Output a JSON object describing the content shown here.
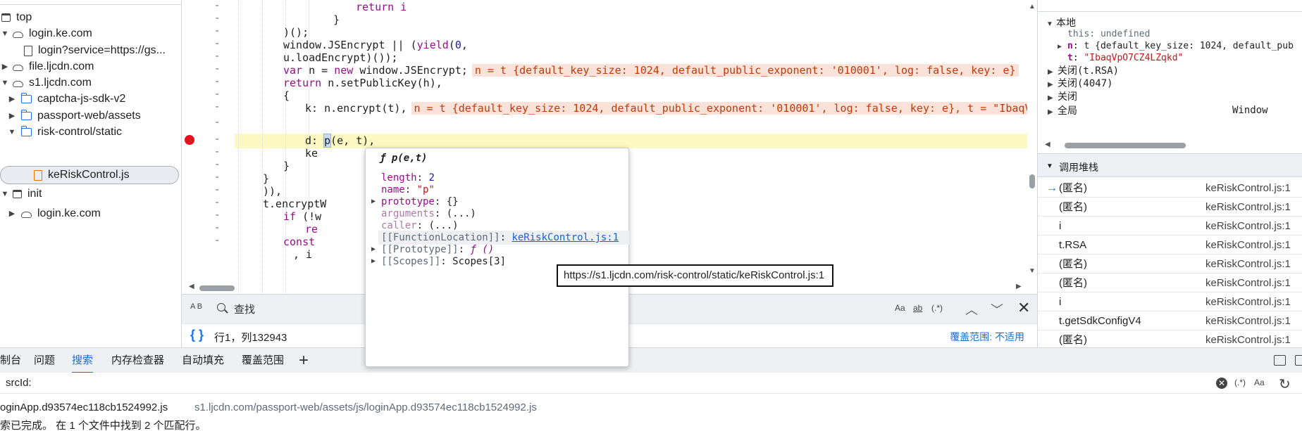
{
  "file_tree": {
    "items": [
      {
        "label": "top",
        "icon": "frame-icon",
        "expanded": true
      },
      {
        "label": "login.ke.com",
        "icon": "cloud-icon",
        "expanded": true
      },
      {
        "label": "login?service=https://gs...",
        "icon": "file-icon"
      },
      {
        "label": "file.ljcdn.com",
        "icon": "cloud-icon",
        "expanded": false
      },
      {
        "label": "s1.ljcdn.com",
        "icon": "cloud-icon",
        "expanded": true
      },
      {
        "label": "captcha-js-sdk-v2",
        "icon": "folder-icon",
        "expanded": false
      },
      {
        "label": "passport-web/assets",
        "icon": "folder-icon",
        "expanded": false
      },
      {
        "label": "risk-control/static",
        "icon": "folder-icon",
        "expanded": true
      },
      {
        "label": "keRiskControl.js",
        "icon": "js-file-icon",
        "selected": true
      },
      {
        "label": "init",
        "icon": "frame-icon",
        "expanded": true
      },
      {
        "label": "login.ke.com",
        "icon": "cloud-icon",
        "expanded": false
      }
    ]
  },
  "editor": {
    "gutter_marker": "-",
    "lines": [
      {
        "t1": "return i"
      },
      {
        "t1": "}"
      },
      {
        "t1": ")();"
      },
      {
        "t1": "window.JSEncrypt || (",
        "t2": "yield",
        "t3": "(",
        "t4": "0",
        "t5": ","
      },
      {
        "t1": "u.loadEncrypt)());"
      },
      {
        "t1": "var",
        "t2": " n = ",
        "t3": "new",
        "t4": " window.JSEncrypt;",
        "inline": "n = t {default_key_size: 1024, default_public_exponent: '010001', log: false, key: e}"
      },
      {
        "t1": "return",
        "t2": " n.setPublicKey(h),"
      },
      {
        "t1": "{"
      },
      {
        "t1": "k: n.encrypt(t),",
        "inline": "n = t {default_key_size: 1024, default_public_exponent: '010001', log: false, key: e}, t = \"IbaqV"
      },
      {
        "t1": "d: ",
        "t2": "p",
        "t3": "(e, t),"
      },
      {
        "t1": "ke"
      },
      {
        "t1": "}"
      },
      {
        "t1": "}"
      },
      {
        "t1": ")),"
      },
      {
        "t1": "t.encryptW"
      },
      {
        "t1": "if",
        "t2": " (!w"
      },
      {
        "t1": "re"
      },
      {
        "t1": "const"
      },
      {
        "t1": ", i"
      }
    ]
  },
  "findbar": {
    "case_icon_label": "A B",
    "placeholder": "查找",
    "opt_case": "Aa",
    "opt_word": "ab",
    "opt_regex": "(.*)"
  },
  "editor_status": {
    "braces": "{ }",
    "position": "行1，列132943",
    "coverage": "覆盖范围: 不适用"
  },
  "scope": {
    "local_header": "本地",
    "this_key": "this",
    "this_val": "undefined",
    "n_key": "n",
    "n_val": "t {default_key_size: 1024, default_pub",
    "t_key": "t",
    "t_val": "\"IbaqVpO7CZ4LZqkd\"",
    "closure1": "关闭(t.RSA)",
    "closure2": "关闭(4047)",
    "closure3": "关闭",
    "global": "全局",
    "global_val": "Window"
  },
  "call_stack": {
    "header": "调用堆栈",
    "frames": [
      {
        "name": "(匿名)",
        "loc": "keRiskControl.js:1",
        "current": true
      },
      {
        "name": "(匿名)",
        "loc": "keRiskControl.js:1"
      },
      {
        "name": "i",
        "loc": "keRiskControl.js:1"
      },
      {
        "name": "t.RSA",
        "loc": "keRiskControl.js:1"
      },
      {
        "name": "(匿名)",
        "loc": "keRiskControl.js:1"
      },
      {
        "name": "(匿名)",
        "loc": "keRiskControl.js:1"
      },
      {
        "name": "i",
        "loc": "keRiskControl.js:1"
      },
      {
        "name": "t.getSdkConfigV4",
        "loc": "keRiskControl.js:1"
      },
      {
        "name": "(匿名)",
        "loc": "keRiskControl.js:1"
      }
    ]
  },
  "drawer": {
    "tabs": [
      "制台",
      "问题",
      "搜索",
      "内存检查器",
      "自动填充",
      "覆盖范围"
    ],
    "active_tab": "搜索",
    "plus": "+",
    "query": "srcId:",
    "result_file": "oginApp.d93574ec118cb1524992.js",
    "result_path": "s1.ljcdn.com/passport-web/assets/js/loginApp.d93574ec118cb1524992.js",
    "status": "索已完成。 在 1 个文件中找到 2 个匹配行。"
  },
  "popover": {
    "title": "ƒ p(e,t)",
    "length_key": "length",
    "length_val": "2",
    "name_key": "name",
    "name_val": "\"p\"",
    "prototype_key": "prototype",
    "prototype_val": "{}",
    "arguments_key": "arguments",
    "arguments_val": "(...)",
    "caller_key": "caller",
    "caller_val": "(...)",
    "fnloc_key": "[[FunctionLocation]]",
    "fnloc_val": "keRiskControl.js:1",
    "proto_key": "[[Prototype]]",
    "proto_val": "ƒ ()",
    "scopes_key": "[[Scopes]]",
    "scopes_val": "Scopes[3]"
  },
  "tooltip": {
    "text": "https://s1.ljcdn.com/risk-control/static/keRiskControl.js:1"
  },
  "colors": {
    "accent": "#1a73e8",
    "breakpoint": "#e5121e",
    "highlight_row": "#fef9c3",
    "inline_value_bg": "#fbe2d9",
    "keyword": "#9a0d8f"
  }
}
